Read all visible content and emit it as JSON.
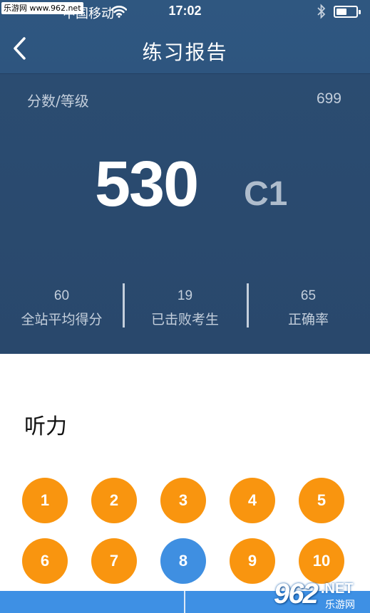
{
  "status_bar": {
    "watermark": "乐游网 www.962.net",
    "carrier": "中国移动",
    "time": "17:02"
  },
  "nav": {
    "title": "练习报告"
  },
  "summary": {
    "score_label": "分数/等级",
    "total": "699",
    "score": "530",
    "grade": "C1",
    "stats": [
      {
        "value": "60",
        "label": "全站平均得分"
      },
      {
        "value": "19",
        "label": "已击败考生"
      },
      {
        "value": "65",
        "label": "正确率"
      }
    ]
  },
  "section": {
    "title": "听力",
    "questions": [
      "1",
      "2",
      "3",
      "4",
      "5",
      "6",
      "7",
      "8",
      "9",
      "10"
    ],
    "current": "8"
  },
  "logo": {
    "number": "962",
    "suffix": ".NET",
    "name": "乐游网"
  },
  "colors": {
    "header_bg": "#29486c",
    "answered": "#f9950f",
    "current": "#3f8fe1",
    "bottom_bar": "#3e90e4"
  },
  "icons": [
    "wifi-icon",
    "bluetooth-icon",
    "battery-icon",
    "back-chevron-icon"
  ]
}
